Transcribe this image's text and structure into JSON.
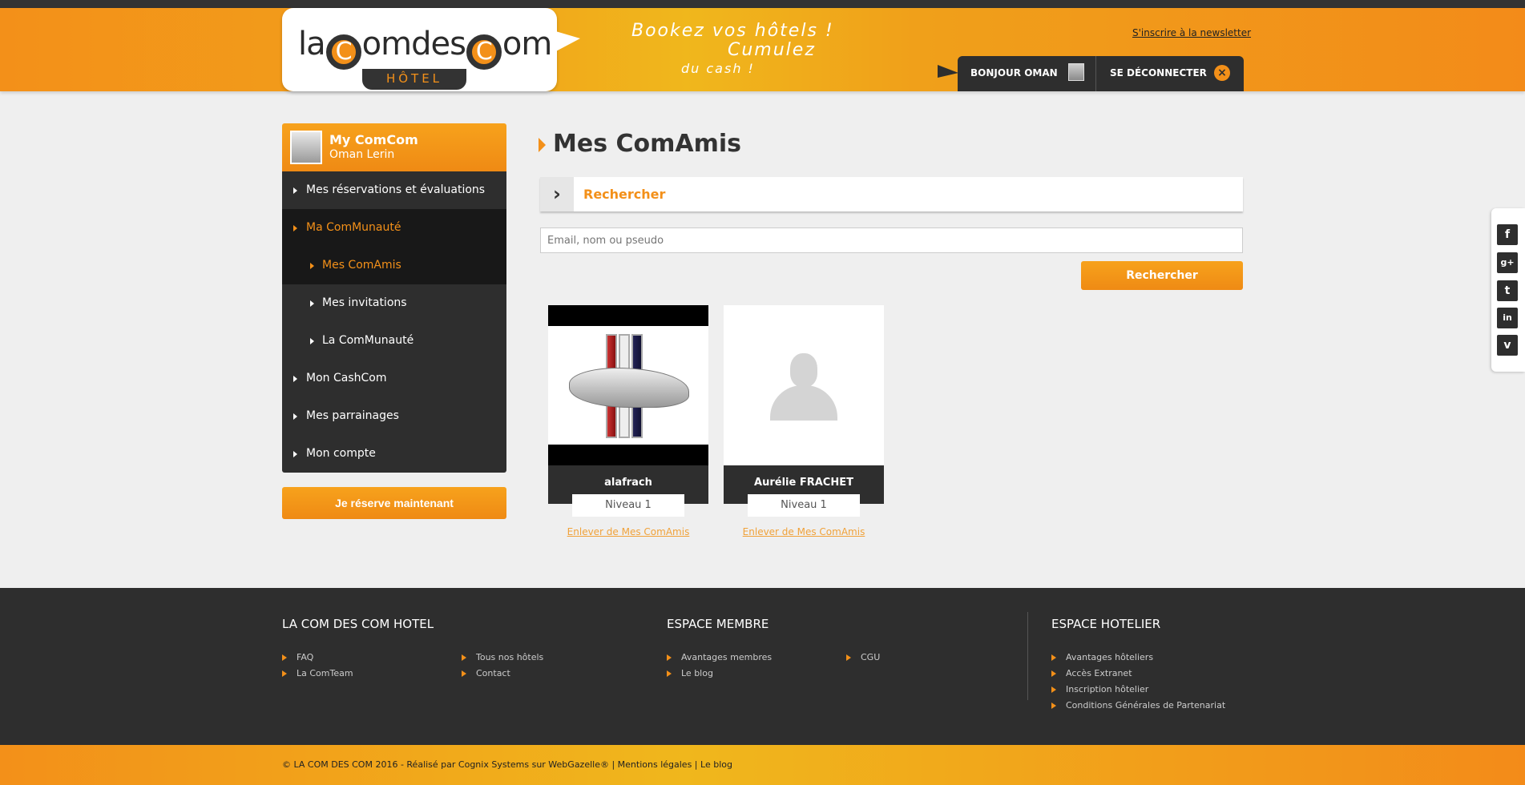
{
  "header": {
    "logo_text_1": "la",
    "logo_c": "C",
    "logo_text_2": "omdes",
    "logo_text_3": "om",
    "logo_hotel": "HÔTEL",
    "slogan_1": "Bookez vos hôtels !",
    "slogan_2": "Cumulez",
    "slogan_3": "du cash !",
    "newsletter": "S'inscrire à la newsletter",
    "hello": "BONJOUR OMAN",
    "logout": "SE DÉCONNECTER"
  },
  "sidebar": {
    "title": "My ComCom",
    "user": "Oman Lerin",
    "items": [
      {
        "label": "Mes réservations et évaluations"
      },
      {
        "label": "Ma ComMunauté"
      },
      {
        "label": "Mes ComAmis"
      },
      {
        "label": "Mes invitations"
      },
      {
        "label": "La ComMunauté"
      },
      {
        "label": "Mon CashCom"
      },
      {
        "label": "Mes parrainages"
      },
      {
        "label": "Mon compte"
      }
    ],
    "reserve": "Je réserve maintenant"
  },
  "main": {
    "title": "Mes ComAmis",
    "search_title": "Rechercher",
    "search_placeholder": "Email, nom ou pseudo",
    "search_button": "Rechercher",
    "friends": [
      {
        "name": "alafrach",
        "level": "Niveau 1",
        "remove": "Enlever de Mes ComAmis"
      },
      {
        "name": "Aurélie FRACHET",
        "level": "Niveau 1",
        "remove": "Enlever de Mes ComAmis"
      }
    ]
  },
  "social": [
    "f",
    "g+",
    "t",
    "in",
    "v"
  ],
  "footer": {
    "col1_title": "LA COM DES COM HOTEL",
    "col1_links": [
      "FAQ",
      "La ComTeam",
      "Tous nos hôtels",
      "Contact"
    ],
    "col2_title": "ESPACE MEMBRE",
    "col2_links": [
      "Avantages membres",
      "Le blog",
      "CGU"
    ],
    "col3_title": "ESPACE HOTELIER",
    "col3_links": [
      "Avantages hôteliers",
      "Accès Extranet",
      "Inscription hôtelier",
      "Conditions Générales de Partenariat"
    ],
    "copyright": "© LA COM DES COM 2016 - Réalisé par Cognix Systems sur WebGazelle® | Mentions légales | Le blog"
  },
  "colors": {
    "accent": "#f39019",
    "dark": "#2e2e2e"
  }
}
